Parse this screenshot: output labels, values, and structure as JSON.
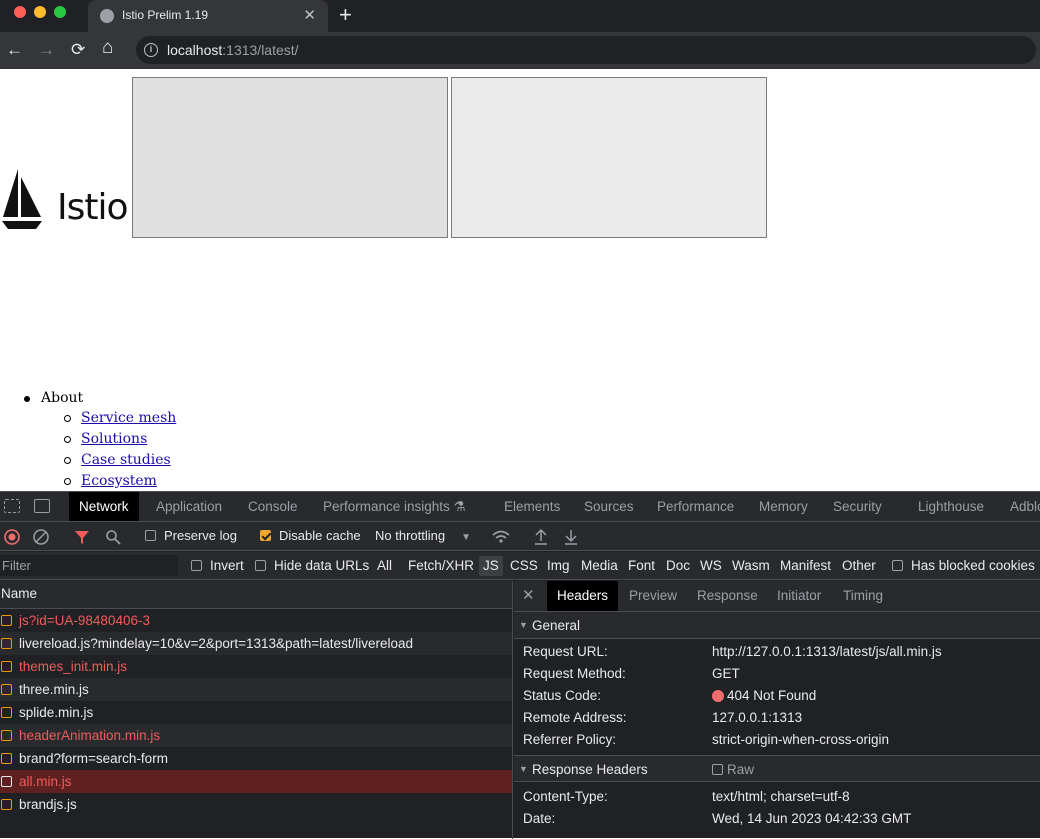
{
  "browser": {
    "tab_title": "Istio Prelim 1.19",
    "tab_close": "✕",
    "new_tab": "+",
    "url_host": "localhost",
    "url_path": ":1313/latest/",
    "back": "←",
    "forward": "→",
    "reload": "⟳",
    "home": "⌂"
  },
  "page": {
    "logo_text": "Istio",
    "menu": {
      "top_item": "About",
      "sub_items": [
        "Service mesh",
        "Solutions",
        "Case studies",
        "Ecosystem"
      ]
    }
  },
  "devtools": {
    "tabs": [
      "Network",
      "Application",
      "Console",
      "Performance insights ⚗",
      "Elements",
      "Sources",
      "Performance",
      "Memory",
      "Security",
      "Lighthouse",
      "Adblo"
    ],
    "toolbar": {
      "preserve_log": "Preserve log",
      "disable_cache": "Disable cache",
      "throttling": "No throttling"
    },
    "filter": {
      "placeholder": "Filter",
      "invert": "Invert",
      "hide_data_urls": "Hide data URLs",
      "types": [
        "All",
        "Fetch/XHR",
        "JS",
        "CSS",
        "Img",
        "Media",
        "Font",
        "Doc",
        "WS",
        "Wasm",
        "Manifest",
        "Other"
      ],
      "selected_type": "JS",
      "blocked_cookies": "Has blocked cookies"
    },
    "requests": {
      "header": "Name",
      "rows": [
        {
          "name": "js?id=UA-98480406-3",
          "status": "error"
        },
        {
          "name": "livereload.js?mindelay=10&v=2&port=1313&path=latest/livereload",
          "status": "ok"
        },
        {
          "name": "themes_init.min.js",
          "status": "error"
        },
        {
          "name": "three.min.js",
          "status": "ok"
        },
        {
          "name": "splide.min.js",
          "status": "ok"
        },
        {
          "name": "headerAnimation.min.js",
          "status": "error"
        },
        {
          "name": "brand?form=search-form",
          "status": "ok"
        },
        {
          "name": "all.min.js",
          "status": "selected"
        },
        {
          "name": "brandjs.js",
          "status": "ok"
        }
      ]
    },
    "details": {
      "tabs": [
        "Headers",
        "Preview",
        "Response",
        "Initiator",
        "Timing"
      ],
      "close": "✕",
      "general_title": "General",
      "general": [
        {
          "k": "Request URL:",
          "v": "http://127.0.0.1:1313/latest/js/all.min.js"
        },
        {
          "k": "Request Method:",
          "v": "GET"
        },
        {
          "k": "Status Code:",
          "v": "404 Not Found"
        },
        {
          "k": "Remote Address:",
          "v": "127.0.0.1:1313"
        },
        {
          "k": "Referrer Policy:",
          "v": "strict-origin-when-cross-origin"
        }
      ],
      "response_title": "Response Headers",
      "raw": "Raw",
      "response": [
        {
          "k": "Content-Type:",
          "v": "text/html; charset=utf-8"
        },
        {
          "k": "Date:",
          "v": "Wed, 14 Jun 2023 04:42:33 GMT"
        }
      ]
    }
  },
  "colors": {
    "error_text": "#f15b5b",
    "selected_row": "#5f2120",
    "status_dot": "#ee6e6e"
  }
}
